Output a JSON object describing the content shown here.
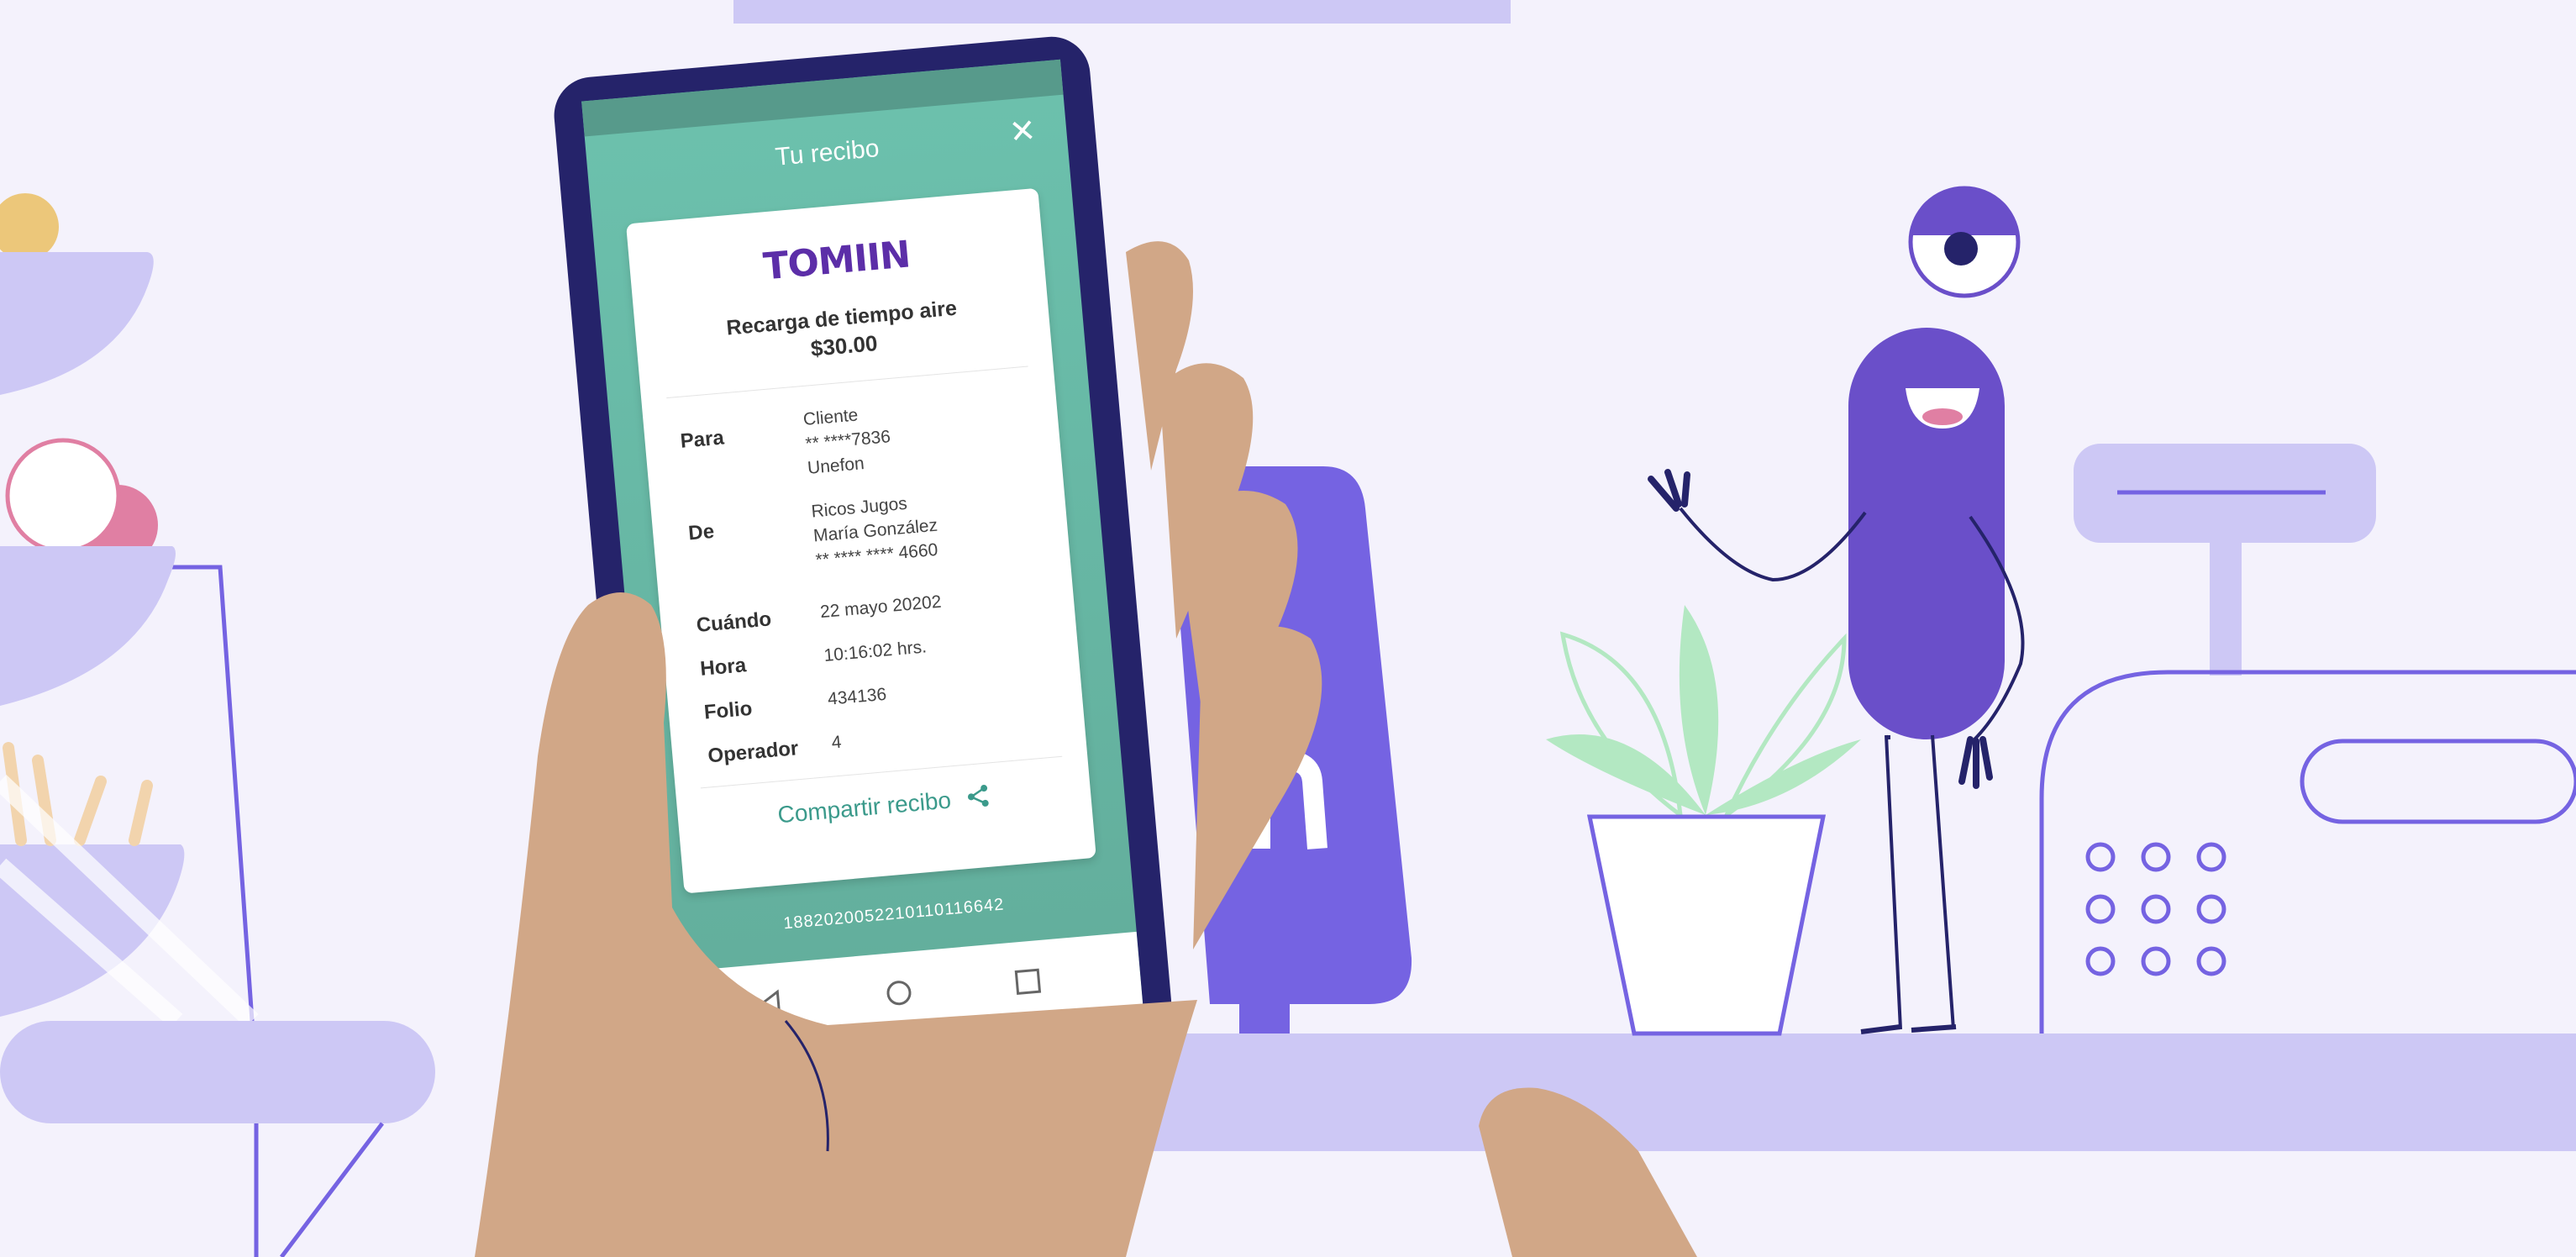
{
  "colors": {
    "background": "#f4f2fc",
    "lavender": "#cdc8f5",
    "purple_accent": "#7563e2",
    "character_purple": "#6a4fc9",
    "plant_green": "#b3e8c2",
    "skin": "#d1a787",
    "phone_frame": "#25236a",
    "screen_teal": "#6cc1ad",
    "brand_purple": "#5c2ea8"
  },
  "screen": {
    "title": "Tu recibo",
    "close_icon": "close-icon"
  },
  "receipt": {
    "brand": "TOMIIN",
    "product": "Recarga de tiempo aire",
    "amount": "$30.00",
    "rows": [
      {
        "label": "Para",
        "lines": [
          "Cliente",
          "** ****7836",
          "Unefon"
        ]
      },
      {
        "label": "De",
        "lines": [
          "Ricos Jugos",
          "María González",
          "** **** **** 4660"
        ]
      },
      {
        "label": "Cuándo",
        "lines": [
          "22 mayo 20202"
        ]
      },
      {
        "label": "Hora",
        "lines": [
          "10:16:02 hrs."
        ]
      },
      {
        "label": "Folio",
        "lines": [
          "434136"
        ]
      },
      {
        "label": "Operador",
        "lines": [
          "4"
        ]
      }
    ],
    "share_label": "Compartir recibo",
    "share_icon": "share-icon"
  },
  "barcode": "1882020052210110116642",
  "nav": {
    "back_icon": "back-icon",
    "home_icon": "home-icon",
    "recents_icon": "recents-icon"
  }
}
